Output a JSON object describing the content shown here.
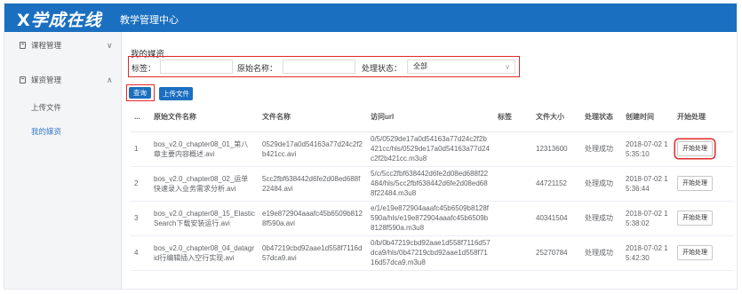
{
  "header": {
    "logo_mark": "X",
    "logo_text": "学成在线",
    "subtitle": "教学管理中心"
  },
  "sidebar": {
    "groups": [
      {
        "label": "课程管理",
        "chevron": "∨"
      },
      {
        "label": "媒资管理",
        "chevron": "∧"
      }
    ],
    "subitems": [
      {
        "label": "上传文件"
      },
      {
        "label": "我的媒资"
      }
    ]
  },
  "page": {
    "title": "我的媒资"
  },
  "filters": {
    "tag_label": "标签：",
    "orig_label": "原始名称：",
    "status_label": "处理状态：",
    "status_value": "全部",
    "status_arrow": "∨"
  },
  "buttons": {
    "query": "查询",
    "upload": "上传文件"
  },
  "table": {
    "headers": [
      "...",
      "原始文件名称",
      "文件名称",
      "访问url",
      "标签",
      "文件大小",
      "处理状态",
      "创建时间",
      "开始处理"
    ],
    "rows": [
      {
        "idx": "1",
        "orig": "bos_v2.0_chapter08_01_第八章主要内容概述.avi",
        "name": "0529de17a0d54163a77d24c2f2b421cc.avi",
        "url": "0/5/0529de17a0d54163a77d24c2f2b421cc/hls/0529de17a0d54163a77d24c2f2b421cc.m3u8",
        "tag": "",
        "size": "12313600",
        "status": "处理成功",
        "time": "2018-07-02 15:35:10",
        "action": "开始处理"
      },
      {
        "idx": "2",
        "orig": "bos_v2.0_chapter08_02_运单快速录入业务需求分析.avi",
        "name": "5cc2fbf638442d6fe2d08ed688f22484.avi",
        "url": "5/c/5cc2fbf638442d6fe2d08ed688f22484/hls/5cc2fbf638442d6fe2d08ed688f22484.m3u8",
        "tag": "",
        "size": "44721152",
        "status": "处理成功",
        "time": "2018-07-02 15:36:44",
        "action": "开始处理"
      },
      {
        "idx": "3",
        "orig": "bos_v2.0_chapter08_15_ElasticSearch下载安装运行.avi",
        "name": "e19e872904aaafc45b6509b8128f590a.avi",
        "url": "e/1/e19e872904aaafc45b6509b8128f590a/hls/e19e872904aaafc45b6509b8128f590a.m3u8",
        "tag": "",
        "size": "40341504",
        "status": "处理成功",
        "time": "2018-07-02 15:38:02",
        "action": "开始处理"
      },
      {
        "idx": "4",
        "orig": "bos_v2.0_chapter08_04_datagrid行编辑插入空行实现.avi",
        "name": "0b47219cbd92aae1d558f7116d57dca9.avi",
        "url": "0/b/0b47219cbd92aae1d558f7116d57dca9/hls/0b47219cbd92aae1d558f7116d57dca9.m3u8",
        "tag": "",
        "size": "25270784",
        "status": "处理成功",
        "time": "2018-07-02 15:42:30",
        "action": "开始处理"
      }
    ]
  },
  "colors": {
    "primary": "#1a6fc0",
    "highlight": "#e02a2a",
    "sidebar_bg": "#f4f5f7"
  }
}
